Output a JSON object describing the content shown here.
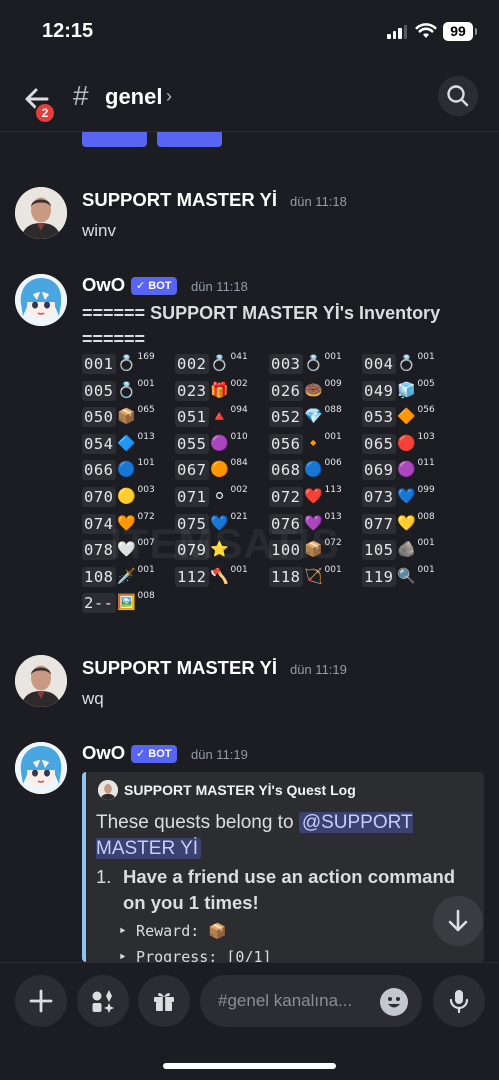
{
  "status": {
    "time": "12:15",
    "battery": "99"
  },
  "header": {
    "unread_count": "2",
    "hash": "#",
    "channel": "genel",
    "chevron": "›"
  },
  "messages": [
    {
      "author": "SUPPORT MASTER Yİ",
      "timestamp": "dün 11:18",
      "text": "winv"
    },
    {
      "author": "OwO",
      "bot_label": "✓ BOT",
      "timestamp": "dün 11:18"
    },
    {
      "author": "SUPPORT MASTER Yİ",
      "timestamp": "dün 11:19",
      "text": "wq"
    },
    {
      "author": "OwO",
      "bot_label": "✓ BOT",
      "timestamp": "dün 11:19"
    }
  ],
  "inventory": {
    "title": "====== SUPPORT MASTER Yİ's Inventory ======",
    "items": [
      {
        "code": "001",
        "emoji": "💍",
        "count": "169"
      },
      {
        "code": "002",
        "emoji": "💍",
        "count": "041"
      },
      {
        "code": "003",
        "emoji": "💍",
        "count": "001"
      },
      {
        "code": "004",
        "emoji": "💍",
        "count": "001"
      },
      {
        "code": "005",
        "emoji": "💍",
        "count": "001"
      },
      {
        "code": "023",
        "emoji": "🎁",
        "count": "002"
      },
      {
        "code": "026",
        "emoji": "🍩",
        "count": "009"
      },
      {
        "code": "049",
        "emoji": "🧊",
        "count": "005"
      },
      {
        "code": "050",
        "emoji": "📦",
        "count": "065"
      },
      {
        "code": "051",
        "emoji": "🔺",
        "count": "094"
      },
      {
        "code": "052",
        "emoji": "💎",
        "count": "088"
      },
      {
        "code": "053",
        "emoji": "🔶",
        "count": "056"
      },
      {
        "code": "054",
        "emoji": "🔷",
        "count": "013"
      },
      {
        "code": "055",
        "emoji": "🟣",
        "count": "010"
      },
      {
        "code": "056",
        "emoji": "🔸",
        "count": "001"
      },
      {
        "code": "065",
        "emoji": "🔴",
        "count": "103"
      },
      {
        "code": "066",
        "emoji": "🔵",
        "count": "101"
      },
      {
        "code": "067",
        "emoji": "🟠",
        "count": "084"
      },
      {
        "code": "068",
        "emoji": "🔵",
        "count": "006"
      },
      {
        "code": "069",
        "emoji": "🟣",
        "count": "011"
      },
      {
        "code": "070",
        "emoji": "🟡",
        "count": "003"
      },
      {
        "code": "071",
        "emoji": "⚪",
        "count": "002"
      },
      {
        "code": "072",
        "emoji": "❤️",
        "count": "113"
      },
      {
        "code": "073",
        "emoji": "💙",
        "count": "099"
      },
      {
        "code": "074",
        "emoji": "🧡",
        "count": "072"
      },
      {
        "code": "075",
        "emoji": "💙",
        "count": "021"
      },
      {
        "code": "076",
        "emoji": "💜",
        "count": "013"
      },
      {
        "code": "077",
        "emoji": "💛",
        "count": "008"
      },
      {
        "code": "078",
        "emoji": "🤍",
        "count": "007"
      },
      {
        "code": "079",
        "emoji": "⭐",
        "count": ""
      },
      {
        "code": "100",
        "emoji": "📦",
        "count": "072"
      },
      {
        "code": "105",
        "emoji": "🪨",
        "count": "001"
      },
      {
        "code": "108",
        "emoji": "🗡️",
        "count": "001"
      },
      {
        "code": "112",
        "emoji": "🪓",
        "count": "001"
      },
      {
        "code": "118",
        "emoji": "🏹",
        "count": "001"
      },
      {
        "code": "119",
        "emoji": "🔍",
        "count": "001"
      },
      {
        "code": "2--",
        "emoji": "🖼️",
        "count": "008"
      }
    ]
  },
  "embed": {
    "author": "SUPPORT MASTER Yİ's Quest Log",
    "desc_prefix": "These quests belong to ",
    "mention": "@SUPPORT MASTER Yİ",
    "quest_number": "1.",
    "quest_text": "Have a friend use an action command on you 1 times!",
    "reward_label": "‣ Reward:",
    "reward_emoji": "📦",
    "progress_label": "‣ Progress: [0/1]"
  },
  "composer": {
    "placeholder": "#genel kanalına..."
  },
  "watermark": "ITEMSATIS"
}
